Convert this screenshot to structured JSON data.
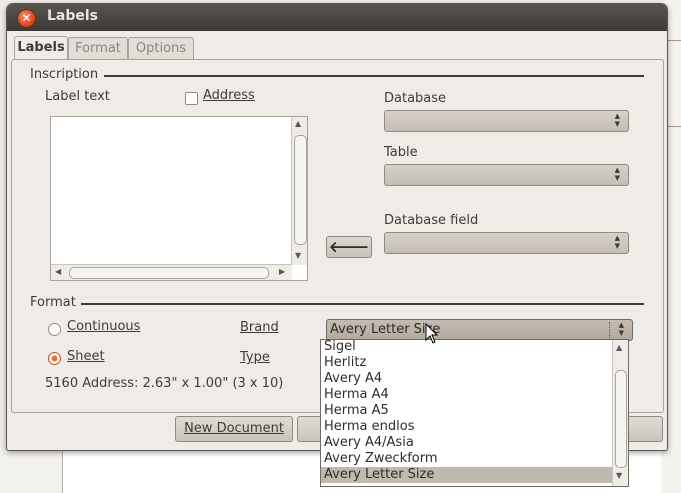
{
  "window": {
    "title": "Labels"
  },
  "tabs": [
    {
      "label": "Labels",
      "active": true
    },
    {
      "label": "Format",
      "active": false
    },
    {
      "label": "Options",
      "active": false
    }
  ],
  "inscription": {
    "section_label": "Inscription",
    "label_text": "Label text",
    "address_label": "Address",
    "address_checked": false,
    "database_label": "Database",
    "table_label": "Table",
    "database_field_label": "Database field",
    "insert_arrow": "🡐"
  },
  "format": {
    "section_label": "Format",
    "continuous_label": "Continuous",
    "sheet_label": "Sheet",
    "selected": "Sheet",
    "brand_label": "Brand",
    "type_label": "Type",
    "brand_value": "Avery Letter Size",
    "info": "5160 Address: 2.63\" x 1.00\" (3 x 10)"
  },
  "brand_options": [
    "Sigel",
    "Herlitz",
    "Avery A4",
    "Herma A4",
    "Herma A5",
    "Herma endlos",
    "Avery A4/Asia",
    "Avery Zweckform",
    "Avery Letter Size"
  ],
  "buttons": {
    "new_document": "New Document"
  },
  "colors": {
    "accent": "#f06a38",
    "titlebar": "#3e3b37",
    "selection": "#c0b9af"
  }
}
